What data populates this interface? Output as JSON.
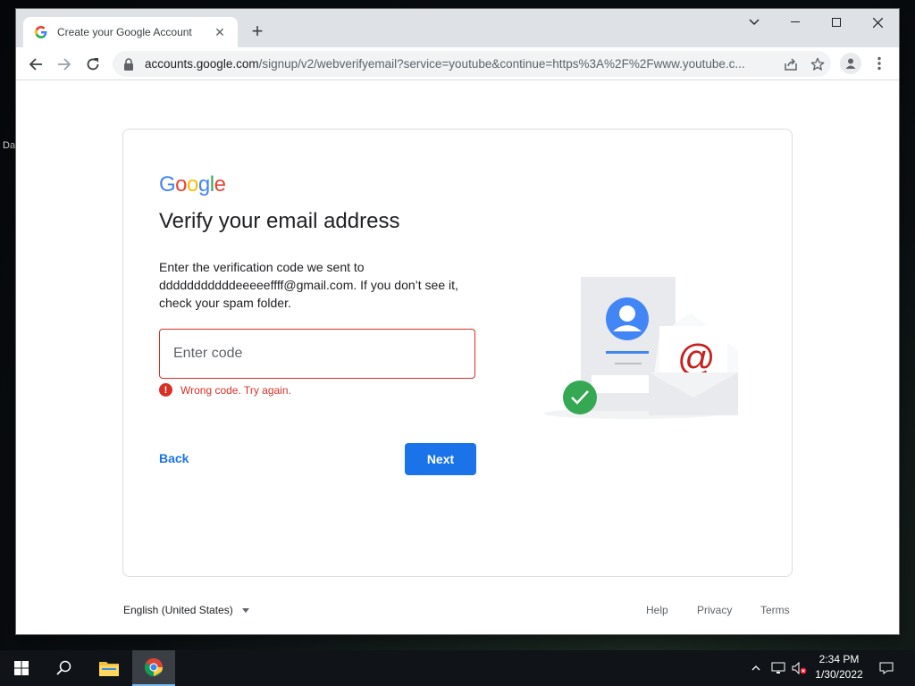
{
  "desktop": {
    "edge_labels": [
      "Da"
    ]
  },
  "browser": {
    "tab_title": "Create your Google Account",
    "url_domain": "accounts.google.com",
    "url_path": "/signup/v2/webverifyemail?service=youtube&continue=https%3A%2F%2Fwww.youtube.c...",
    "icons": [
      "back-icon",
      "forward-icon",
      "reload-icon",
      "lock-icon",
      "share-icon",
      "star-icon",
      "profile-icon",
      "menu-icon",
      "minimize-icon",
      "maximize-icon",
      "close-icon",
      "tab-search-icon"
    ]
  },
  "page": {
    "logo": {
      "letters": [
        "G",
        "o",
        "o",
        "g",
        "l",
        "e"
      ],
      "colors": [
        "#4285F4",
        "#EA4335",
        "#FBBC05",
        "#4285F4",
        "#34A853",
        "#EA4335"
      ]
    },
    "heading": "Verify your email address",
    "description_line1": "Enter the verification code we sent to",
    "description_line2": "dddddddddddeeeeeffff@gmail.com. If you don’t see it,",
    "description_line3": "check your spam folder.",
    "code_input": {
      "placeholder": "Enter code",
      "value": ""
    },
    "error": {
      "icon": "!",
      "text": "Wrong code. Try again."
    },
    "back_label": "Back",
    "next_label": "Next",
    "illustration": {
      "at_symbol": "@"
    }
  },
  "footer": {
    "language": "English (United States)",
    "help": "Help",
    "privacy": "Privacy",
    "terms": "Terms"
  },
  "taskbar": {
    "time": "2:34 PM",
    "date": "1/30/2022"
  },
  "colors": {
    "accent": "#1a73e8",
    "error": "#d93025"
  }
}
